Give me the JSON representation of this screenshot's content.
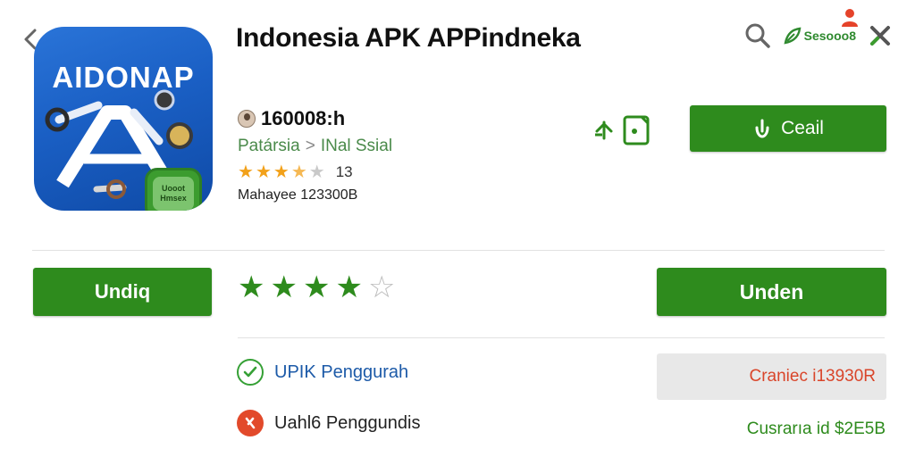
{
  "header": {
    "title": "Indonesia APK APPindneka",
    "sesame_label": "Sesooo8"
  },
  "app_icon": {
    "wordmark": "AIDONAP",
    "badge_text": "Uooot Hmsex"
  },
  "developer": {
    "name": "160008:h"
  },
  "category": {
    "primary": "Patársia",
    "separator": ">",
    "secondary": "INal Ssial"
  },
  "rating": {
    "stars_value": 3.5,
    "count": "13"
  },
  "meta": {
    "text": "Mahayee 123300B"
  },
  "buttons": {
    "call_label": "Ceail",
    "left_label": "Undiq",
    "right_label": "Unden"
  },
  "big_rating": {
    "filled_stars": 4,
    "total_stars": 5
  },
  "info": {
    "row1_label": "UPIK Penggurah",
    "row2_label": "Uahl6 Penggundis"
  },
  "prices": {
    "box_text": "Craniec i13930R",
    "green_text": "Cusrarıa id $2E5B"
  },
  "colors": {
    "brand_green": "#2e8b1d",
    "icon_blue": "#1a5fc4",
    "star_orange": "#f2a11a",
    "price_red": "#d9452a"
  },
  "icons": {
    "back": "chevron-left-icon",
    "search": "search-icon",
    "close": "close-icon",
    "leaf": "leaf-icon",
    "flag": "person-flag-icon",
    "check": "check-circle-icon",
    "x_mark": "x-circle-icon",
    "hand": "hand-icon",
    "share": "share-icon",
    "wishlist": "wishlist-icon"
  }
}
